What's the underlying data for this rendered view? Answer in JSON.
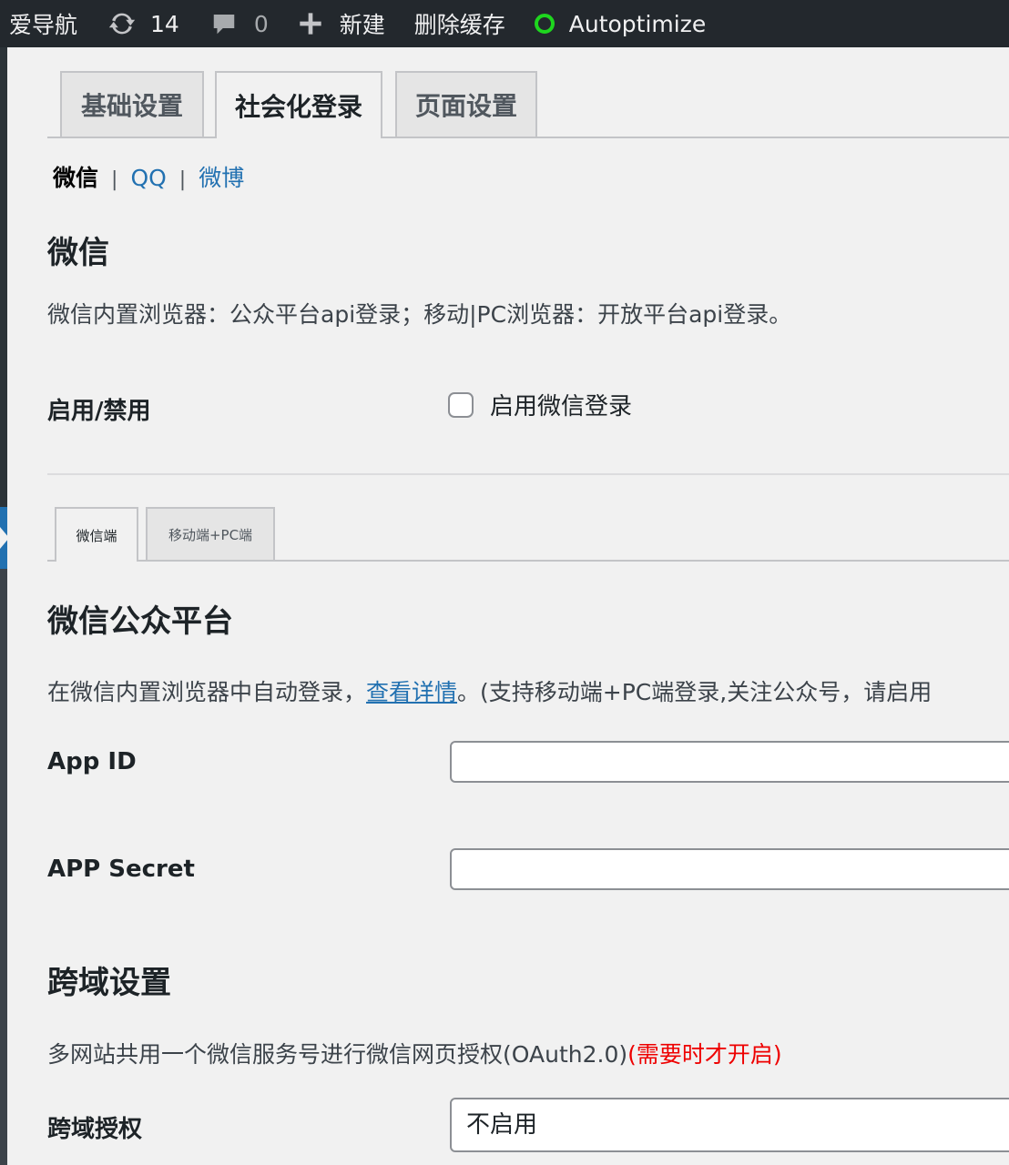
{
  "admin_bar": {
    "site_name": "爱导航",
    "updates_count": "14",
    "comments_count": "0",
    "new_label": "新建",
    "purge_cache_label": "删除缓存",
    "autoptimize_label": "Autoptimize",
    "autoptimize_status_color": "#1ed61e"
  },
  "main_tabs": [
    {
      "label": "基础设置",
      "active": false
    },
    {
      "label": "社会化登录",
      "active": true
    },
    {
      "label": "页面设置",
      "active": false
    }
  ],
  "sub_nav": {
    "current": "微信",
    "separator": "|",
    "links": [
      "QQ",
      "微博"
    ]
  },
  "wechat_section": {
    "heading": "微信",
    "description": "微信内置浏览器：公众平台api登录；移动|PC浏览器：开放平台api登录。",
    "enable_label": "启用/禁用",
    "enable_checkbox_label": "启用微信登录",
    "enable_checked": false
  },
  "inner_tabs": [
    {
      "label": "微信端",
      "active": true
    },
    {
      "label": "移动端+PC端",
      "active": false
    }
  ],
  "mp_section": {
    "heading": "微信公众平台",
    "desc_before": "在微信内置浏览器中自动登录，",
    "desc_link": "查看详情",
    "desc_after": "。(支持移动端+PC端登录,关注公众号，请启用",
    "app_id_label": "App ID",
    "app_id_value": "",
    "app_secret_label": "APP Secret",
    "app_secret_value": ""
  },
  "cross_domain": {
    "heading": "跨域设置",
    "desc": "多网站共用一个微信服务号进行微信网页授权(OAuth2.0)",
    "desc_note": "(需要时才开启)",
    "auth_label": "跨域授权",
    "auth_selected": "不启用"
  },
  "colors": {
    "admin_bar_bg": "#23282d",
    "link": "#2271b1",
    "warning": "#e00000"
  }
}
